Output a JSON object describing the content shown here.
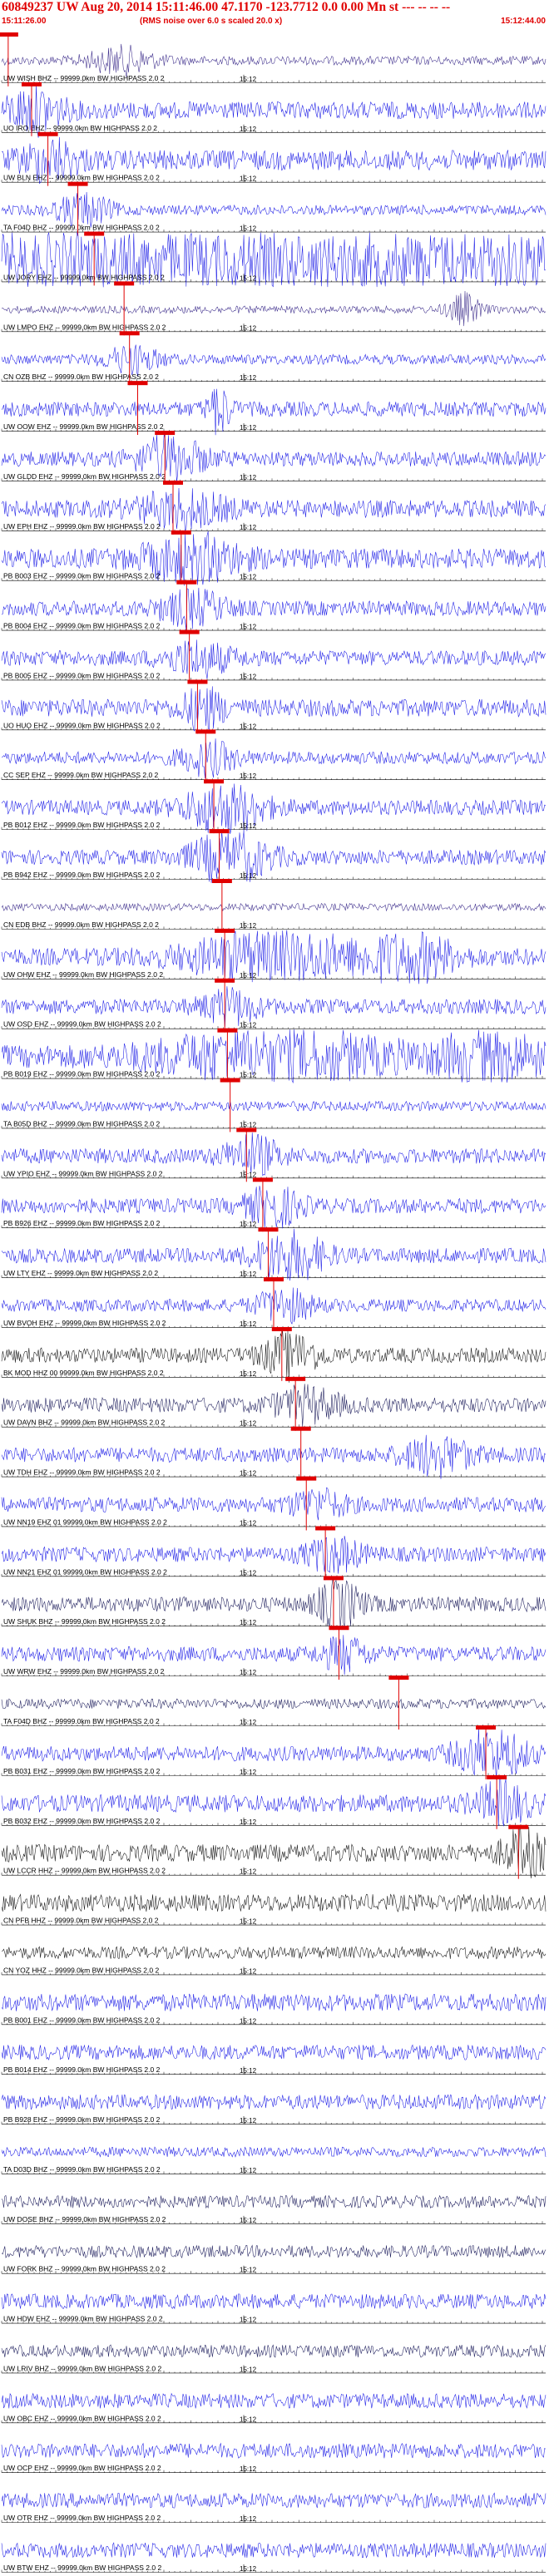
{
  "header": {
    "title": "60849237 UW Aug 20, 2014 15:11:46.00   47.1170 -123.7712  0.0 0.00 Mn st --- -- -- --",
    "start_time": "15:11:26.00",
    "end_time": "15:12:44.00",
    "rms_note": "(RMS noise over 6.0 s scaled 20.0 x)"
  },
  "colors": {
    "pick": "#e00000",
    "blue": "#1a1ae6",
    "dark": "#1a1a5a",
    "black": "#111111",
    "purple": "#3a2a8a"
  },
  "chart_data": {
    "type": "line",
    "title": "60849237 UW Aug 20, 2014 15:11:46.00   47.1170 -123.7712  0.0 0.00 Mn st --- -- -- --",
    "time_range": [
      "15:11:26.00",
      "15:12:44.00"
    ],
    "tick_label": "15:12",
    "series": [
      {
        "label": "UW WISH BHZ -- 99999.0km BW  HIGHPASS  2.0  2",
        "pick": 0.012,
        "color": "purple",
        "amp": 0.18,
        "bursts": [
          [
            0.22,
            0.5,
            0.06
          ]
        ]
      },
      {
        "label": "UO IRO EHZ -- 99999.0km BW  HIGHPASS  2.0  2",
        "pick": 0.055,
        "color": "blue",
        "amp": 0.35,
        "bursts": [
          [
            0.06,
            0.8,
            0.05
          ]
        ]
      },
      {
        "label": "UW BLN EHZ -- 99999.0km BW  HIGHPASS  2.0  2",
        "pick": 0.085,
        "color": "blue",
        "amp": 0.4,
        "bursts": [
          [
            0.09,
            0.7,
            0.05
          ]
        ]
      },
      {
        "label": "TA F04D BHZ -- 99999.0km BW  HIGHPASS  2.0  2",
        "pick": 0.14,
        "color": "blue",
        "amp": 0.2,
        "bursts": [
          [
            0.15,
            0.6,
            0.05
          ]
        ]
      },
      {
        "label": "UW JORY EHZ -- 99999.0km BW  HIGHPASS  2.0  2",
        "pick": 0.17,
        "color": "blue",
        "amp": 0.9,
        "bursts": [
          [
            0.27,
            0.95,
            0.2
          ],
          [
            0.75,
            0.95,
            0.25
          ]
        ]
      },
      {
        "label": "UW LMPO EHZ -- 99999.0km BW  HIGHPASS  2.0  2",
        "pick": 0.225,
        "color": "purple",
        "amp": 0.15,
        "bursts": [
          [
            0.85,
            0.6,
            0.03
          ]
        ]
      },
      {
        "label": "CN OZB BHZ -- 99999.0km BW  HIGHPASS  2.0  2",
        "pick": 0.235,
        "color": "blue",
        "amp": 0.2,
        "bursts": [
          [
            0.24,
            0.5,
            0.05
          ]
        ]
      },
      {
        "label": "UW OOW EHZ -- 99999.0km BW  HIGHPASS  2.0  2",
        "pick": 0.25,
        "color": "blue",
        "amp": 0.3,
        "bursts": [
          [
            0.4,
            0.9,
            0.02
          ]
        ]
      },
      {
        "label": "UW GLDD EHZ -- 99999.0km BW  HIGHPASS  2.0  2",
        "pick": 0.3,
        "color": "blue",
        "amp": 0.3,
        "bursts": [
          [
            0.31,
            0.8,
            0.06
          ]
        ]
      },
      {
        "label": "UW EPH EHZ -- 99999.0km BW  HIGHPASS  2.0  2",
        "pick": 0.315,
        "color": "blue",
        "amp": 0.35,
        "bursts": [
          [
            0.33,
            0.6,
            0.08
          ]
        ]
      },
      {
        "label": "PB B003 EHZ -- 99999.0km BW  HIGHPASS  2.0  2",
        "pick": 0.33,
        "color": "blue",
        "amp": 0.4,
        "bursts": [
          [
            0.35,
            0.9,
            0.08
          ]
        ]
      },
      {
        "label": "PB B004 EHZ -- 99999.0km BW  HIGHPASS  2.0  2",
        "pick": 0.34,
        "color": "blue",
        "amp": 0.3,
        "bursts": [
          [
            0.35,
            0.6,
            0.06
          ]
        ]
      },
      {
        "label": "PB B005 EHZ -- 99999.0km BW  HIGHPASS  2.0  2",
        "pick": 0.345,
        "color": "blue",
        "amp": 0.3,
        "bursts": [
          [
            0.36,
            0.6,
            0.06
          ]
        ]
      },
      {
        "label": "UO HUO EHZ -- 99999.0km BW  HIGHPASS  2.0  2",
        "pick": 0.36,
        "color": "blue",
        "amp": 0.35,
        "bursts": [
          [
            0.37,
            0.7,
            0.04
          ]
        ]
      },
      {
        "label": "CC SEP EHZ -- 99999.0km BW  HIGHPASS  2.0  2",
        "pick": 0.375,
        "color": "blue",
        "amp": 0.25,
        "bursts": [
          [
            0.38,
            0.6,
            0.05
          ]
        ]
      },
      {
        "label": "PB B012 EHZ -- 99999.0km BW  HIGHPASS  2.0  2",
        "pick": 0.39,
        "color": "blue",
        "amp": 0.3,
        "bursts": [
          [
            0.41,
            0.95,
            0.07
          ]
        ]
      },
      {
        "label": "PB B942 EHZ -- 99999.0km BW  HIGHPASS  2.0  2",
        "pick": 0.4,
        "color": "blue",
        "amp": 0.3,
        "bursts": [
          [
            0.42,
            0.95,
            0.07
          ]
        ]
      },
      {
        "label": "CN EDB BHZ -- 99999.0km BW  HIGHPASS  2.0  2",
        "pick": 0.405,
        "color": "purple",
        "amp": 0.15,
        "bursts": []
      },
      {
        "label": "UW OHW EHZ -- 99999.0km BW  HIGHPASS  2.0  2",
        "pick": 0.41,
        "color": "blue",
        "amp": 0.35,
        "bursts": [
          [
            0.5,
            0.95,
            0.15
          ],
          [
            0.75,
            0.85,
            0.08
          ]
        ]
      },
      {
        "label": "UW OSD EHZ -- 99999.0km BW  HIGHPASS  2.0  2",
        "pick": 0.41,
        "color": "blue",
        "amp": 0.3,
        "bursts": [
          [
            0.42,
            0.6,
            0.05
          ]
        ]
      },
      {
        "label": "PB B019 EHZ -- 99999.0km BW  HIGHPASS  2.0  2",
        "pick": 0.415,
        "color": "blue",
        "amp": 0.45,
        "bursts": [
          [
            0.5,
            0.95,
            0.2
          ],
          [
            0.9,
            0.8,
            0.1
          ]
        ]
      },
      {
        "label": "TA B05D BHZ -- 99999.0km BW  HIGHPASS  2.0  2",
        "pick": 0.42,
        "color": "blue",
        "amp": 0.2,
        "bursts": []
      },
      {
        "label": "UW YPIO EHZ -- 99999.0km BW  HIGHPASS  2.0  2",
        "pick": 0.45,
        "color": "blue",
        "amp": 0.3,
        "bursts": [
          [
            0.46,
            0.7,
            0.05
          ]
        ]
      },
      {
        "label": "PB B926 EHZ -- 99999.0km BW  HIGHPASS  2.0  2",
        "pick": 0.48,
        "color": "blue",
        "amp": 0.3,
        "bursts": [
          [
            0.5,
            0.7,
            0.05
          ]
        ]
      },
      {
        "label": "UW LTY EHZ -- 99999.0km BW  HIGHPASS  2.0  2",
        "pick": 0.49,
        "color": "blue",
        "amp": 0.3,
        "bursts": [
          [
            0.53,
            0.95,
            0.06
          ]
        ]
      },
      {
        "label": "UW BVOH EHZ -- 99999.0km BW  HIGHPASS  2.0  2",
        "pick": 0.5,
        "color": "blue",
        "amp": 0.25,
        "bursts": [
          [
            0.52,
            0.6,
            0.05
          ]
        ]
      },
      {
        "label": "BK MOD HHZ 00 99999.0km BW  HIGHPASS  2.0  2",
        "pick": 0.515,
        "color": "black",
        "amp": 0.3,
        "bursts": [
          [
            0.53,
            0.8,
            0.05
          ]
        ]
      },
      {
        "label": "UW DAVN BHZ -- 99999.0km BW  HIGHPASS  2.0  2",
        "pick": 0.54,
        "color": "dark",
        "amp": 0.3,
        "bursts": [
          [
            0.56,
            0.6,
            0.06
          ]
        ]
      },
      {
        "label": "UW TDH EHZ -- 99999.0km BW  HIGHPASS  2.0  2",
        "pick": 0.55,
        "color": "blue",
        "amp": 0.3,
        "bursts": [
          [
            0.8,
            0.7,
            0.06
          ]
        ]
      },
      {
        "label": "UW NN19 EHZ 01 99999.0km BW  HIGHPASS  2.0  2",
        "pick": 0.56,
        "color": "blue",
        "amp": 0.3,
        "bursts": [
          [
            0.58,
            0.5,
            0.05
          ]
        ]
      },
      {
        "label": "UW NN21 EHZ 01 99999.0km BW  HIGHPASS  2.0  2",
        "pick": 0.595,
        "color": "blue",
        "amp": 0.3,
        "bursts": [
          [
            0.61,
            0.6,
            0.05
          ]
        ]
      },
      {
        "label": "UW SHUK BHZ -- 99999.0km BW  HIGHPASS  2.0  2",
        "pick": 0.61,
        "color": "dark",
        "amp": 0.3,
        "bursts": [
          [
            0.62,
            0.9,
            0.04
          ]
        ]
      },
      {
        "label": "UW WRW EHZ -- 99999.0km BW  HIGHPASS  2.0  2",
        "pick": 0.62,
        "color": "blue",
        "amp": 0.3,
        "bursts": [
          [
            0.63,
            0.6,
            0.04
          ]
        ]
      },
      {
        "label": "TA F04D BHZ -- 99999.0km BW  HIGHPASS  2.0  2",
        "pick": 0.73,
        "color": "dark",
        "amp": 0.2,
        "bursts": []
      },
      {
        "label": "PB B031 EHZ -- 99999.0km BW  HIGHPASS  2.0  2",
        "pick": 0.89,
        "color": "blue",
        "amp": 0.3,
        "bursts": [
          [
            0.9,
            0.95,
            0.06
          ]
        ]
      },
      {
        "label": "PB B032 EHZ -- 99999.0km BW  HIGHPASS  2.0  2",
        "pick": 0.91,
        "color": "blue",
        "amp": 0.35,
        "bursts": [
          [
            0.92,
            0.7,
            0.05
          ]
        ]
      },
      {
        "label": "UW LCCR HHZ -- 99999.0km BW  HIGHPASS  2.0  2",
        "pick": 0.95,
        "color": "black",
        "amp": 0.35,
        "bursts": [
          [
            0.96,
            0.8,
            0.04
          ]
        ]
      },
      {
        "label": "CN PFB HHZ -- 99999.0km BW  HIGHPASS  2.0  2",
        "pick": null,
        "color": "black",
        "amp": 0.35,
        "bursts": []
      },
      {
        "label": "CN YOZ HHZ -- 99999.0km BW  HIGHPASS  2.0  2",
        "pick": null,
        "color": "black",
        "amp": 0.25,
        "bursts": []
      },
      {
        "label": "PB B001 EHZ -- 99999.0km BW  HIGHPASS  2.0  2",
        "pick": null,
        "color": "blue",
        "amp": 0.35,
        "bursts": []
      },
      {
        "label": "PB B014 EHZ -- 99999.0km BW  HIGHPASS  2.0  2",
        "pick": null,
        "color": "blue",
        "amp": 0.3,
        "bursts": []
      },
      {
        "label": "PB B928 EHZ -- 99999.0km BW  HIGHPASS  2.0  2",
        "pick": null,
        "color": "blue",
        "amp": 0.3,
        "bursts": []
      },
      {
        "label": "TA D03D BHZ -- 99999.0km BW  HIGHPASS  2.0  2",
        "pick": null,
        "color": "blue",
        "amp": 0.2,
        "bursts": []
      },
      {
        "label": "UW DOSE BHZ -- 99999.0km BW  HIGHPASS  2.0  2",
        "pick": null,
        "color": "dark",
        "amp": 0.25,
        "bursts": []
      },
      {
        "label": "UW FORK BHZ -- 99999.0km BW  HIGHPASS  2.0  2",
        "pick": null,
        "color": "dark",
        "amp": 0.25,
        "bursts": []
      },
      {
        "label": "UW HDW EHZ -- 99999.0km BW  HIGHPASS  2.0  2",
        "pick": null,
        "color": "blue",
        "amp": 0.3,
        "bursts": []
      },
      {
        "label": "UW LRIV BHZ -- 99999.0km BW  HIGHPASS  2.0  2",
        "pick": null,
        "color": "dark",
        "amp": 0.25,
        "bursts": []
      },
      {
        "label": "UW OBC EHZ -- 99999.0km BW  HIGHPASS  2.0  2",
        "pick": null,
        "color": "blue",
        "amp": 0.3,
        "bursts": []
      },
      {
        "label": "UW OCP EHZ -- 99999.0km BW  HIGHPASS  2.0  2",
        "pick": null,
        "color": "blue",
        "amp": 0.3,
        "bursts": []
      },
      {
        "label": "UW OTR EHZ -- 99999.0km BW  HIGHPASS  2.0  2",
        "pick": null,
        "color": "blue",
        "amp": 0.3,
        "bursts": []
      },
      {
        "label": "UW BTW EHZ -- 99999.0km BW  HIGHPASS  2.0  2",
        "pick": null,
        "color": "blue",
        "amp": 0.3,
        "bursts": []
      }
    ]
  }
}
